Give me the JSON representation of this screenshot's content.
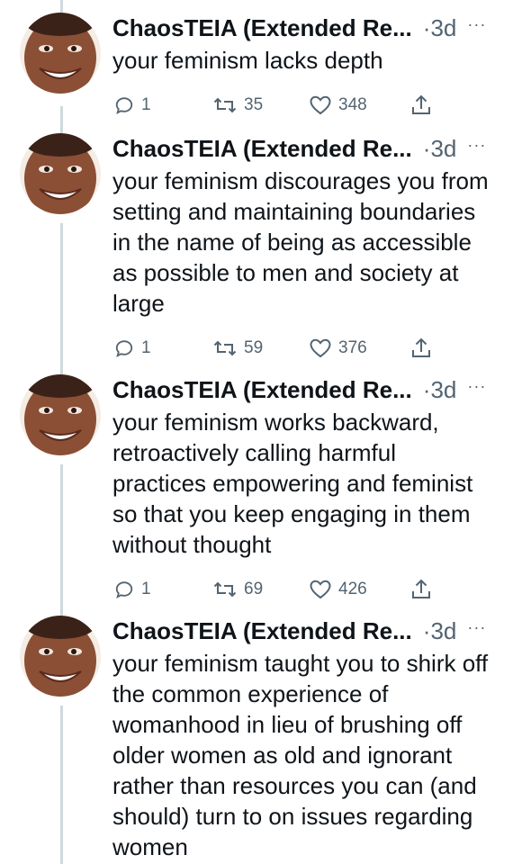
{
  "thread": {
    "tweets": [
      {
        "author": "ChaosTEIA (Extended Re...",
        "separator": "·",
        "time": "3d",
        "more": "···",
        "text": "your feminism lacks depth",
        "replies": "1",
        "retweets": "35",
        "likes": "348",
        "icons": {
          "reply": "reply-icon",
          "retweet": "retweet-icon",
          "like": "heart-icon",
          "share": "share-icon"
        }
      },
      {
        "author": "ChaosTEIA (Extended Re...",
        "separator": "·",
        "time": "3d",
        "more": "···",
        "text": "your feminism discourages you from setting and maintaining boundaries in the name of being as accessible as possible to men and society at large",
        "replies": "1",
        "retweets": "59",
        "likes": "376",
        "icons": {
          "reply": "reply-icon",
          "retweet": "retweet-icon",
          "like": "heart-icon",
          "share": "share-icon"
        }
      },
      {
        "author": "ChaosTEIA (Extended Re...",
        "separator": "·",
        "time": "3d",
        "more": "···",
        "text": "your feminism works backward, retroactively calling harmful practices empowering and feminist so that you keep engaging in them without thought",
        "replies": "1",
        "retweets": "69",
        "likes": "426",
        "icons": {
          "reply": "reply-icon",
          "retweet": "retweet-icon",
          "like": "heart-icon",
          "share": "share-icon"
        }
      },
      {
        "author": "ChaosTEIA (Extended Re...",
        "separator": "·",
        "time": "3d",
        "more": "···",
        "text": "your feminism taught you to shirk off the common experience of womanhood in lieu of brushing off older women as old and ignorant rather than resources you can (and should) turn to on issues regarding women",
        "icons": {
          "reply": "reply-icon",
          "retweet": "retweet-icon",
          "like": "heart-icon",
          "share": "share-icon"
        }
      }
    ]
  },
  "colors": {
    "text": "#0f1419",
    "secondary": "#536471",
    "thread_line": "#cfd9de"
  }
}
